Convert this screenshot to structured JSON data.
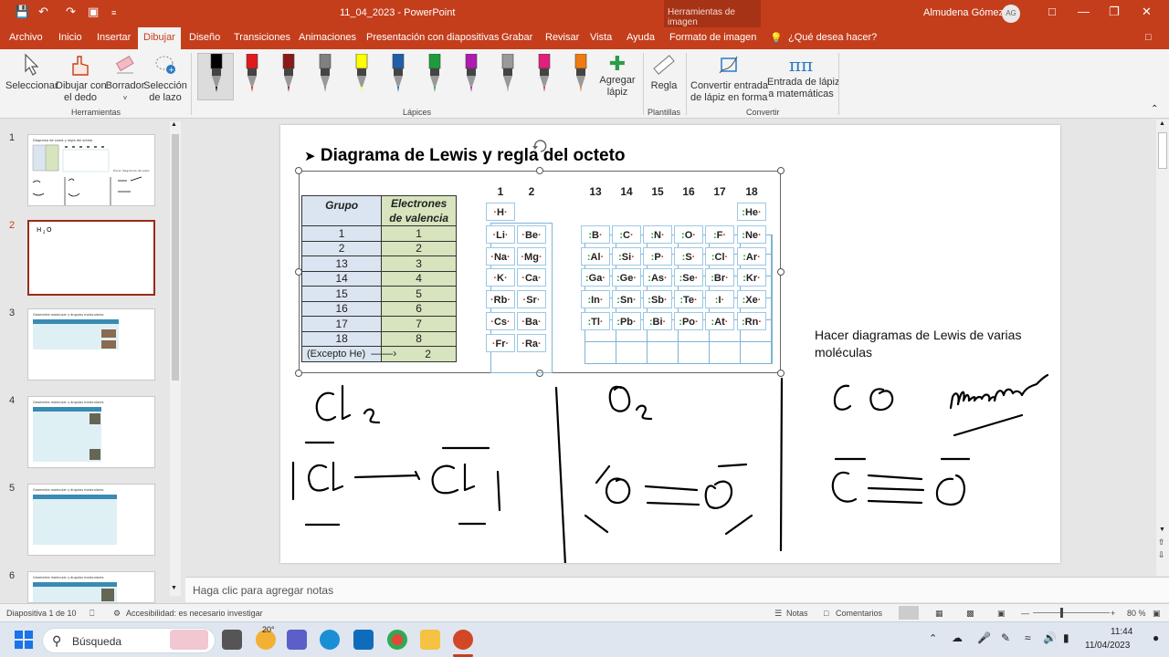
{
  "titlebar": {
    "doc_title": "11_04_2023  -  PowerPoint",
    "context_tab": "Herramientas de imagen",
    "user": "Almudena Gómez",
    "initials": "AG"
  },
  "tabs": [
    "Archivo",
    "Inicio",
    "Insertar",
    "Dibujar",
    "Diseño",
    "Transiciones",
    "Animaciones",
    "Presentación con diapositivas",
    "Grabar",
    "Revisar",
    "Vista",
    "Ayuda",
    "Formato de imagen"
  ],
  "tell_me": "¿Qué desea hacer?",
  "ribbon": {
    "tools": {
      "select": "Seleccionar",
      "finger1": "Dibujar con",
      "finger2": "el dedo",
      "eraser": "Borrador",
      "lasso1": "Selección",
      "lasso2": "de lazo"
    },
    "add_pen1": "Agregar",
    "add_pen2": "lápiz",
    "ruler": "Regla",
    "convert1a": "Convertir entrada",
    "convert1b": "de lápiz en forma",
    "convert2a": "Entrada de lápiz",
    "convert2b": "a matemáticas",
    "groups": {
      "tools": "Herramientas",
      "pens": "Lápices",
      "templates": "Plantillas",
      "convert": "Convertir"
    },
    "pen_colors": [
      "#000000",
      "#e01b1b",
      "#8b1a1a",
      "#808080",
      "#ffff00",
      "#1f5fa8",
      "#1e9b3c",
      "#b01ab0",
      "#9a9a9a",
      "#e0207a",
      "#f07a10"
    ]
  },
  "thumbs": [
    {
      "num": "1",
      "title": "Diagrama de Lewis y regla del octeto"
    },
    {
      "num": "2",
      "title": "H2O"
    },
    {
      "num": "3",
      "title": "Geometría molecular y ángulos moleculares"
    },
    {
      "num": "4",
      "title": "Geometría molecular y ángulos moleculares"
    },
    {
      "num": "5",
      "title": "Geometría molecular y ángulos moleculares"
    },
    {
      "num": "6",
      "title": "Geometría molecular y ángulos moleculares"
    }
  ],
  "slide": {
    "title": "Diagrama de Lewis y regla del octeto",
    "table_head": [
      "Grupo",
      "Electrones",
      "de valencia"
    ],
    "table_rows": [
      [
        "1",
        "1"
      ],
      [
        "2",
        "2"
      ],
      [
        "13",
        "3"
      ],
      [
        "14",
        "4"
      ],
      [
        "15",
        "5"
      ],
      [
        "16",
        "6"
      ],
      [
        "17",
        "7"
      ],
      [
        "18",
        "8"
      ]
    ],
    "except_label": "(Excepto He)",
    "except_value": "2",
    "group_labels": [
      "1",
      "2",
      "13",
      "14",
      "15",
      "16",
      "17",
      "18"
    ],
    "elements": [
      [
        "H",
        "",
        "",
        "",
        "",
        "",
        "",
        "He"
      ],
      [
        "Li",
        "Be",
        "B",
        "C",
        "N",
        "O",
        "F",
        "Ne"
      ],
      [
        "Na",
        "Mg",
        "Al",
        "Si",
        "P",
        "S",
        "Cl",
        "Ar"
      ],
      [
        "K",
        "Ca",
        "Ga",
        "Ge",
        "As",
        "Se",
        "Br",
        "Kr"
      ],
      [
        "Rb",
        "Sr",
        "In",
        "Sn",
        "Sb",
        "Te",
        "I",
        "Xe"
      ],
      [
        "Cs",
        "Ba",
        "Tl",
        "Pb",
        "Bi",
        "Po",
        "At",
        "Rn"
      ],
      [
        "Fr",
        "Ra",
        "",
        "",
        "",
        "",
        "",
        ""
      ]
    ],
    "side_text": "Hacer diagramas de Lewis de varias moléculas"
  },
  "notes_placeholder": "Haga clic para agregar notas",
  "status": {
    "slide": "Diapositiva 1 de 10",
    "access": "Accesibilidad: es necesario investigar",
    "notes": "Notas",
    "comments": "Comentarios",
    "zoom": "80 %"
  },
  "taskbar": {
    "search": "Búsqueda",
    "temp": "20°",
    "time": "11:44",
    "date": "11/04/2023"
  }
}
